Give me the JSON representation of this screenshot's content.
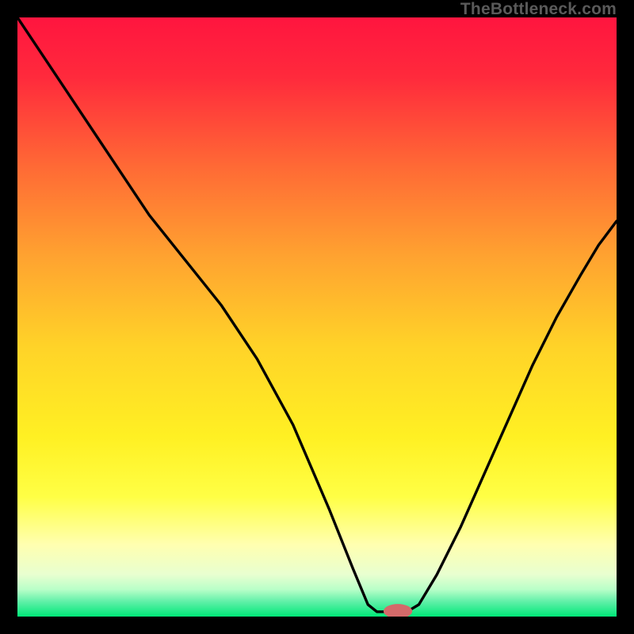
{
  "watermark": "TheBottleneck.com",
  "chart_data": {
    "type": "line",
    "title": "",
    "xlabel": "",
    "ylabel": "",
    "xlim": [
      0,
      100
    ],
    "ylim": [
      0,
      100
    ],
    "gradient_stops": [
      {
        "offset": 0.0,
        "color": "#ff153f"
      },
      {
        "offset": 0.1,
        "color": "#ff2a3c"
      },
      {
        "offset": 0.25,
        "color": "#ff6a35"
      },
      {
        "offset": 0.4,
        "color": "#ffa330"
      },
      {
        "offset": 0.55,
        "color": "#ffd328"
      },
      {
        "offset": 0.7,
        "color": "#fff023"
      },
      {
        "offset": 0.8,
        "color": "#ffff45"
      },
      {
        "offset": 0.88,
        "color": "#ffffb0"
      },
      {
        "offset": 0.93,
        "color": "#e8ffd0"
      },
      {
        "offset": 0.955,
        "color": "#b8ffc8"
      },
      {
        "offset": 0.975,
        "color": "#60f0a8"
      },
      {
        "offset": 1.0,
        "color": "#00e878"
      }
    ],
    "series": [
      {
        "name": "bottleneck-curve",
        "x": [
          0,
          8,
          16,
          22,
          28,
          34,
          40,
          46,
          52,
          56,
          58.5,
          60,
          62,
          65,
          67,
          70,
          74,
          78,
          82,
          86,
          90,
          94,
          97,
          100
        ],
        "y": [
          100,
          88,
          76,
          67,
          59.5,
          52,
          43,
          32,
          18,
          8,
          2,
          0.8,
          0.8,
          0.8,
          2,
          7,
          15,
          24,
          33,
          42,
          50,
          57,
          62,
          66
        ]
      }
    ],
    "marker": {
      "x": 63.5,
      "y": 0.9,
      "rx": 2.4,
      "ry": 1.2,
      "fill": "#d46a6a"
    }
  }
}
